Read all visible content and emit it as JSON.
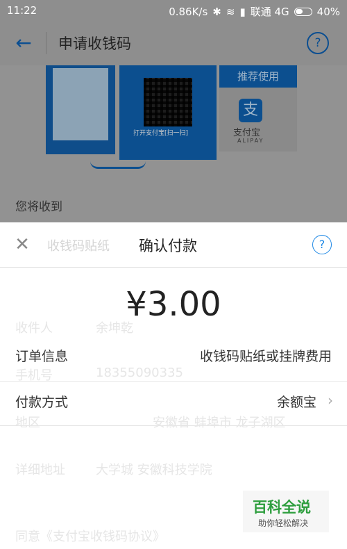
{
  "status_bar": {
    "time": "11:22",
    "speed": "0.86K/s",
    "carrier": "联通 4G",
    "battery": "40%"
  },
  "app_bar": {
    "title": "申请收钱码",
    "help_icon": "?"
  },
  "background_page": {
    "banner_recommend": "推荐使用",
    "banner_qr_caption": "打开支付宝[扫一扫]",
    "logo_glyph": "支",
    "logo_text": "支付宝",
    "logo_sub": "ALIPAY",
    "receive_label": "您将收到",
    "ghost_item": "收钱码贴纸",
    "ghost_fields": [
      {
        "label": "收件人",
        "value": "余坤乾"
      },
      {
        "label": "手机号",
        "value": "18355090335"
      },
      {
        "label": "地区",
        "value": "安徽省 蚌埠市 龙子湖区"
      },
      {
        "label": "详细地址",
        "value": "大学城 安徽科技学院"
      }
    ],
    "ghost_footer": "同意《支付宝收钱码协议》"
  },
  "sheet": {
    "close_icon": "✕",
    "title": "确认付款",
    "help_icon": "?",
    "amount": "¥3.00",
    "order_label": "订单信息",
    "order_value": "收钱码贴纸或挂牌费用",
    "pay_label": "付款方式",
    "pay_value": "余额宝"
  },
  "watermark": {
    "title": "百科全说",
    "subtitle": "助你轻松解决"
  },
  "colors": {
    "primary_blue": "#1e88e5",
    "dim_overlay": "#8e8e8e",
    "watermark_green": "#2e9e3e"
  }
}
